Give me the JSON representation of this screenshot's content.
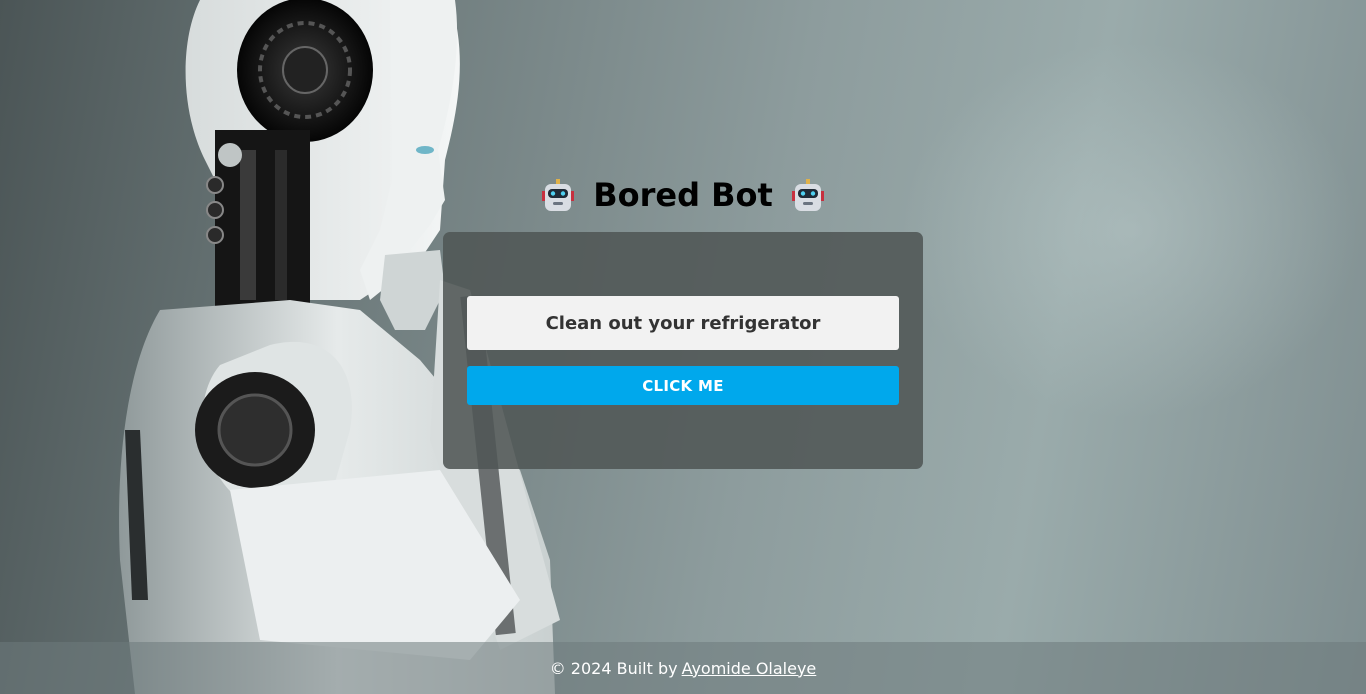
{
  "header": {
    "title": "Bored Bot",
    "left_icon": "robot-face-icon",
    "right_icon": "robot-face-icon"
  },
  "card": {
    "activity": "Clean out your refrigerator",
    "button_label": "CLICK ME"
  },
  "footer": {
    "prefix": "© 2024 Built by",
    "author_link": "Ayomide Olaleye"
  },
  "colors": {
    "button": "#00a8ec",
    "card_bg": "#505655",
    "activity_bg": "#f2f2f2"
  },
  "background_image": "humanoid-robot-thinking-photo"
}
